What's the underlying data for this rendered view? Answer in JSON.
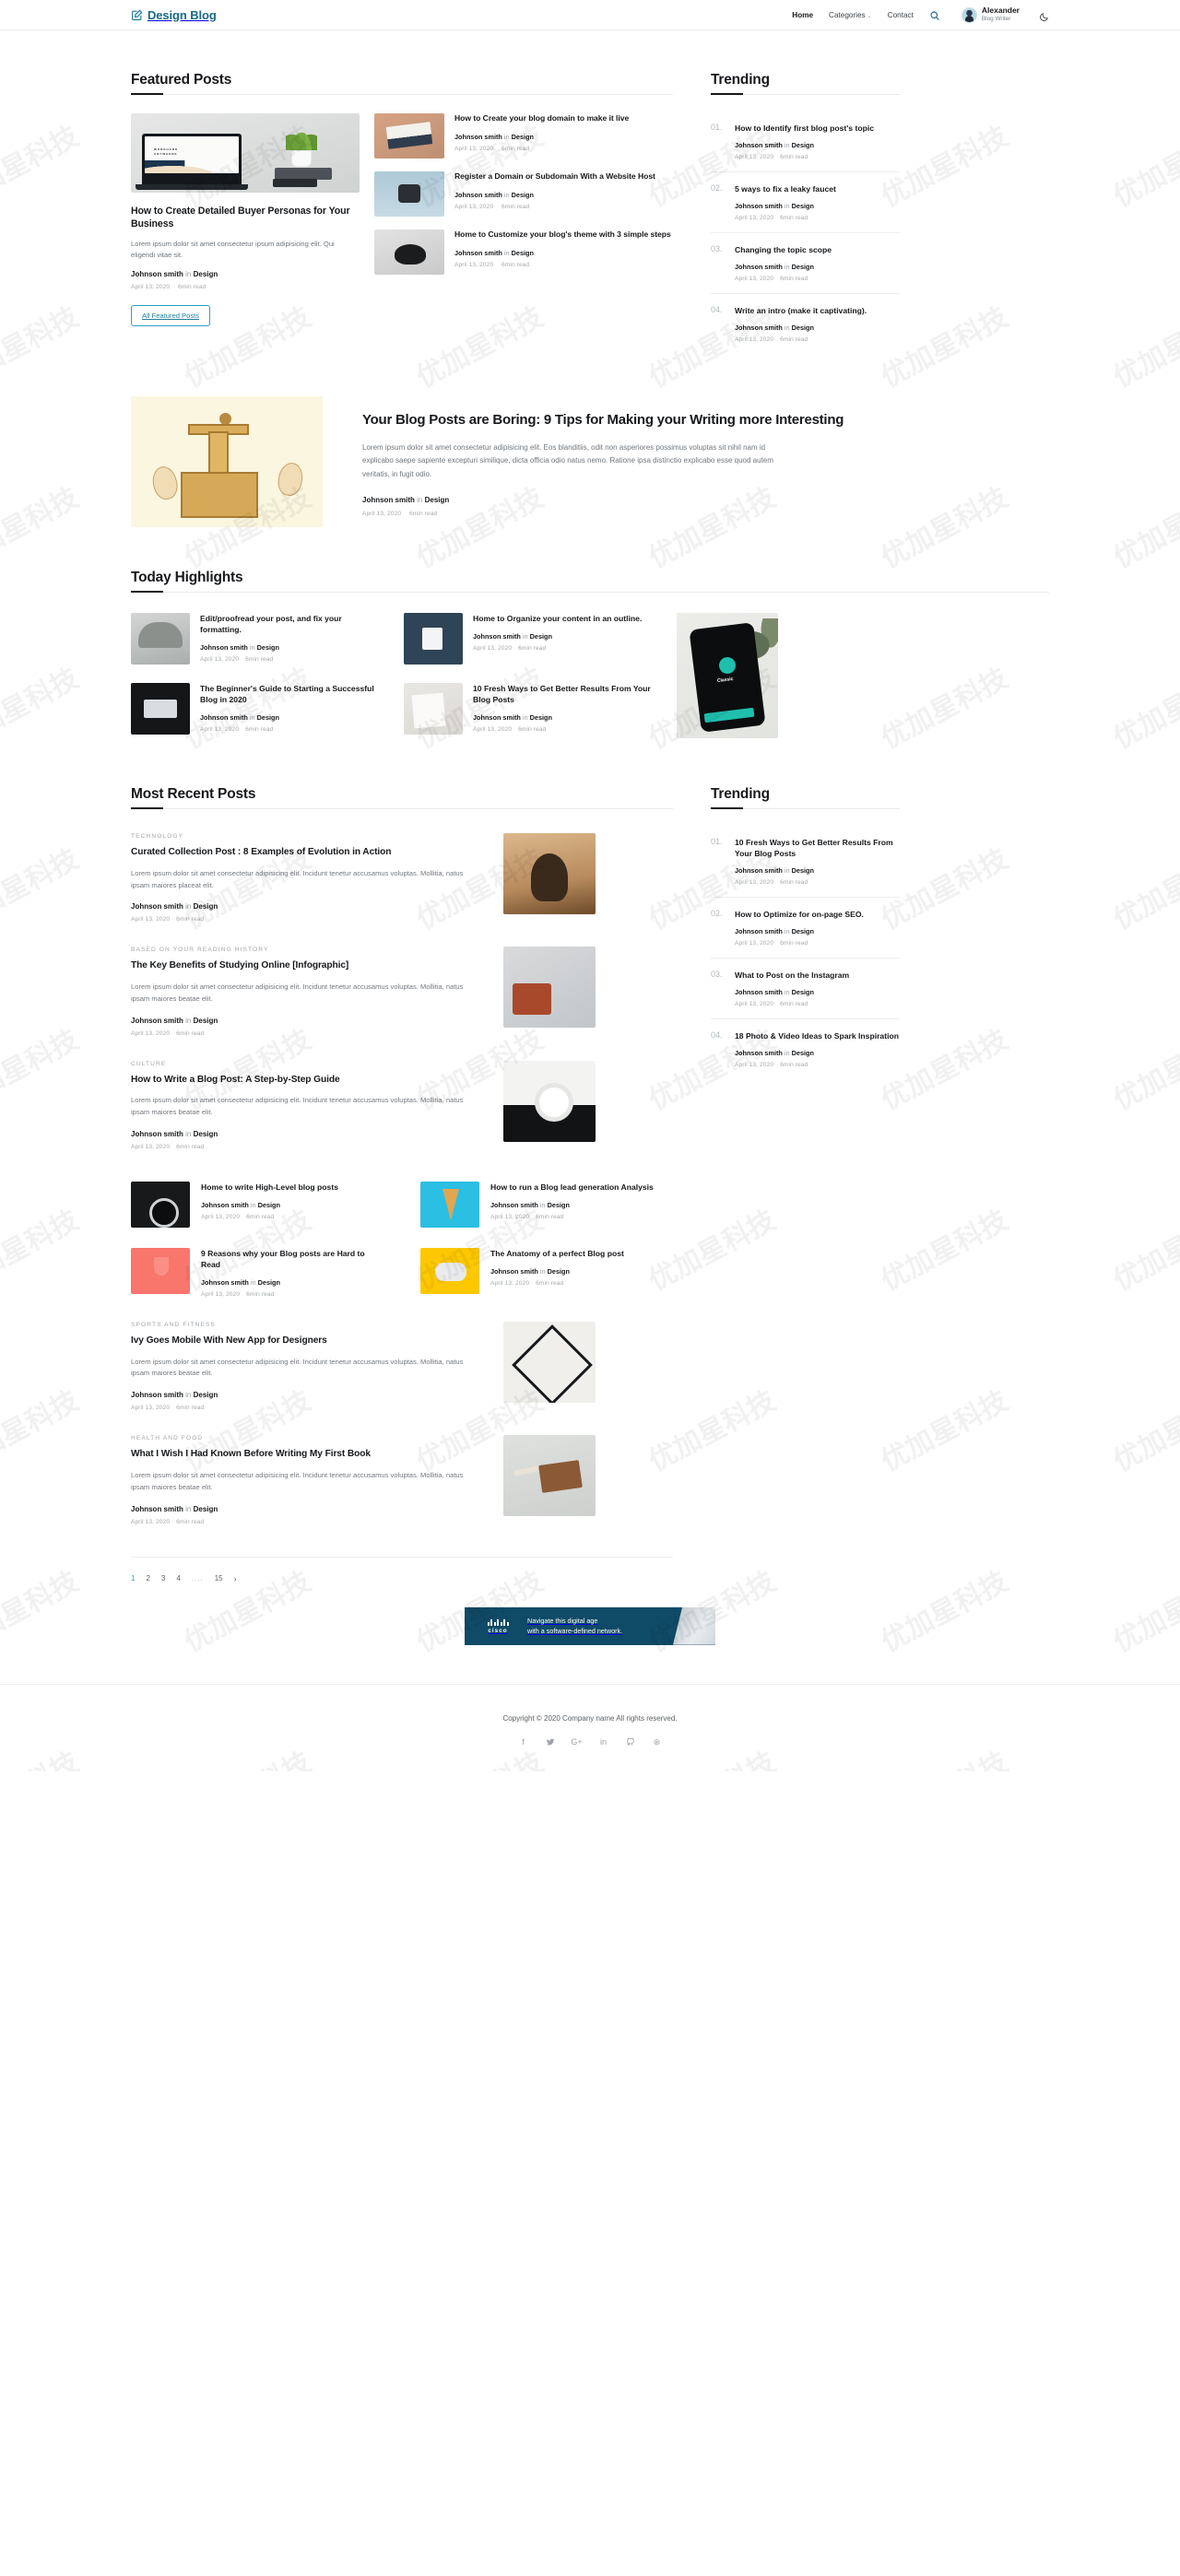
{
  "header": {
    "brand": "Design Blog",
    "brand_icon": "pencil-square-icon",
    "nav": [
      {
        "label": "Home",
        "active": true
      },
      {
        "label": "Categories",
        "caret": "⌄",
        "active": false
      },
      {
        "label": "Contact",
        "active": false
      }
    ],
    "search_icon": "search-icon",
    "user": {
      "name": "Alexander",
      "role": "Blog Writer",
      "avatar": "user-avatar"
    },
    "theme_toggle_icon": "moon-icon"
  },
  "featured": {
    "title": "Featured Posts",
    "main": {
      "title": "How to Create Detailed Buyer Personas for Your Business",
      "excerpt": "Lorem ipsum dolor sit amet consectetur ipsum adipisicing elit. Qui eligendi vitae sit.",
      "author": "Johnson smith",
      "in": "in",
      "category": "Design",
      "date": "April 13, 2020",
      "read": "6min read",
      "button": "All Featured Posts"
    },
    "items": [
      {
        "title": "How to Create your blog domain to make it live",
        "author": "Johnson smith",
        "in": "in",
        "category": "Design",
        "date": "April 13, 2020",
        "read": "6min read",
        "thumb": "books-thumb"
      },
      {
        "title": "Register a Domain or Subdomain With a Website Host",
        "author": "Johnson smith",
        "in": "in",
        "category": "Design",
        "date": "April 13, 2020",
        "read": "6min read",
        "thumb": "watch-thumb"
      },
      {
        "title": "Home to Customize your blog's theme with 3 simple steps",
        "author": "Johnson smith",
        "in": "in",
        "category": "Design",
        "date": "April 13, 2020",
        "read": "6min read",
        "thumb": "mouse-thumb"
      }
    ]
  },
  "trending_top": {
    "title": "Trending",
    "items": [
      {
        "num": "01.",
        "title": "How to Identify first blog post's topic",
        "author": "Johnson smith",
        "in": "in",
        "category": "Design",
        "date": "April 13, 2020",
        "read": "6min read"
      },
      {
        "num": "02.",
        "title": "5 ways to fix a leaky faucet",
        "author": "Johnson smith",
        "in": "in",
        "category": "Design",
        "date": "April 13, 2020",
        "read": "6min read"
      },
      {
        "num": "03.",
        "title": "Changing the topic scope",
        "author": "Johnson smith",
        "in": "in",
        "category": "Design",
        "date": "April 13, 2020",
        "read": "6min read"
      },
      {
        "num": "04.",
        "title": "Write an intro (make it captivating).",
        "author": "Johnson smith",
        "in": "in",
        "category": "Design",
        "date": "April 13, 2020",
        "read": "6min read"
      }
    ]
  },
  "hero": {
    "image": "printing-press-illustration",
    "title": "Your Blog Posts are Boring: 9 Tips for Making your Writing more Interesting",
    "excerpt": "Lorem ipsum dolor sit amet consectetur adipisicing elit. Eos blanditiis, odit non asperiores possimus voluptas sit nihil nam id explicabo saepe sapiente excepturi similique, dicta officia odio natus nemo. Ratione ipsa distinctio explicabo esse quod autem veritatis, in fugit odio.",
    "author": "Johnson smith",
    "in": "in",
    "category": "Design",
    "date": "April 13, 2020",
    "read": "6min read"
  },
  "highlights": {
    "title": "Today Highlights",
    "col1": [
      {
        "title": "Edit/proofread your post, and fix your formatting.",
        "author": "Johnson smith",
        "in": "in",
        "category": "Design",
        "date": "April 13, 2020",
        "read": "6min read",
        "thumb": "cap-thumb"
      },
      {
        "title": "The Beginner's Guide to Starting a Successful Blog in 2020",
        "author": "Johnson smith",
        "in": "in",
        "category": "Design",
        "date": "April 13, 2020",
        "read": "6min read",
        "thumb": "black-thumb"
      }
    ],
    "col2": [
      {
        "title": "Home to Organize your content in an outline.",
        "author": "Johnson smith",
        "in": "in",
        "category": "Design",
        "date": "April 13, 2020",
        "read": "6min read",
        "thumb": "mug-thumb"
      },
      {
        "title": "10 Fresh Ways to Get Better Results From Your Blog Posts",
        "author": "Johnson smith",
        "in": "in",
        "category": "Design",
        "date": "April 13, 2020",
        "read": "6min read",
        "thumb": "note-thumb"
      }
    ],
    "side_image": "phone-classic-app"
  },
  "recent": {
    "title": "Most Recent Posts",
    "posts": [
      {
        "kicker": "TECHNOLOGY",
        "title": "Curated Collection Post : 8 Examples of Evolution in Action",
        "excerpt": "Lorem ipsum dolor sit amet consectetur adipisicing elit. Incidunt tenetur accusamus voluptas. Mollitia, natus ipsam maiores placeat elit.",
        "author": "Johnson smith",
        "in": "in",
        "category": "Design",
        "date": "April 13, 2020",
        "read": "6min read",
        "image": "portrait-image"
      },
      {
        "kicker": "BASED ON YOUR READING HISTORY",
        "title": "The Key Benefits of Studying Online [Infographic]",
        "excerpt": "Lorem ipsum dolor sit amet consectetur adipisicing elit. Incidunt tenetur accusamus voluptas. Mollitia, natus ipsam maiores beatae elit.",
        "author": "Johnson smith",
        "in": "in",
        "category": "Design",
        "date": "April 13, 2020",
        "read": "6min read",
        "image": "flatlay-image"
      },
      {
        "kicker": "CULTURE",
        "title": "How to Write a Blog Post: A Step-by-Step Guide",
        "excerpt": "Lorem ipsum dolor sit amet consectetur adipisicing elit. Incidunt tenetur accusamus voluptas. Mollitia, natus ipsam maiores beatae elit.",
        "author": "Johnson smith",
        "in": "in",
        "category": "Design",
        "date": "April 13, 2020",
        "read": "6min read",
        "image": "coffee-image"
      }
    ],
    "cards": [
      {
        "title": "Home to write High-Level blog posts",
        "author": "Johnson smith",
        "in": "in",
        "category": "Design",
        "date": "April 13, 2020",
        "read": "6min read",
        "image": "coffee-card"
      },
      {
        "title": "How to run a Blog lead generation Analysis",
        "author": "Johnson smith",
        "in": "in",
        "category": "Design",
        "date": "April 13, 2020",
        "read": "6min read",
        "image": "cone-card"
      },
      {
        "title": "9 Reasons why your Blog posts are Hard to Read",
        "author": "Johnson smith",
        "in": "in",
        "category": "Design",
        "date": "April 13, 2020",
        "read": "6min read",
        "image": "glass-card"
      },
      {
        "title": "The Anatomy of a perfect Blog post",
        "author": "Johnson smith",
        "in": "in",
        "category": "Design",
        "date": "April 13, 2020",
        "read": "6min read",
        "image": "gamepad-card"
      }
    ],
    "posts_tail": [
      {
        "kicker": "SPORTS AND FITNESS",
        "title": "Ivy Goes Mobile With New App for Designers",
        "excerpt": "Lorem ipsum dolor sit amet consectetur adipisicing elit. Incidunt tenetur accusamus voluptas. Mollitia, natus ipsam maiores beatae elit.",
        "author": "Johnson smith",
        "in": "in",
        "category": "Design",
        "date": "April 13, 2020",
        "read": "6min read",
        "image": "geometric-image"
      },
      {
        "kicker": "HEALTH AND FOOD",
        "title": "What I Wish I Had Known Before Writing My First Book",
        "excerpt": "Lorem ipsum dolor sit amet consectetur adipisicing elit. Incidunt tenetur accusamus voluptas. Mollitia, natus ipsam maiores beatae elit.",
        "author": "Johnson smith",
        "in": "in",
        "category": "Design",
        "date": "April 13, 2020",
        "read": "6min read",
        "image": "book-image"
      }
    ]
  },
  "trending_bottom": {
    "title": "Trending",
    "items": [
      {
        "num": "01.",
        "title": "10 Fresh Ways to Get Better Results From Your Blog Posts",
        "author": "Johnson smith",
        "in": "in",
        "category": "Design",
        "date": "April 13, 2020",
        "read": "6min read"
      },
      {
        "num": "02.",
        "title": "How to Optimize for on-page SEO.",
        "author": "Johnson smith",
        "in": "in",
        "category": "Design",
        "date": "April 13, 2020",
        "read": "6min read"
      },
      {
        "num": "03.",
        "title": "What to Post on the Instagram",
        "author": "Johnson smith",
        "in": "in",
        "category": "Design",
        "date": "April 13, 2020",
        "read": "6min read"
      },
      {
        "num": "04.",
        "title": "18 Photo & Video Ideas to Spark Inspiration",
        "author": "Johnson smith",
        "in": "in",
        "category": "Design",
        "date": "April 13, 2020",
        "read": "6min read"
      }
    ]
  },
  "pagination": {
    "pages": [
      "1",
      "2",
      "3",
      "4"
    ],
    "dots": "....",
    "last": "15",
    "next_icon": "›",
    "current": "1"
  },
  "ad": {
    "brand": "cisco",
    "line1": "Navigate this digital age",
    "line2": "with a software-defined network.",
    "bg_color": "#0f4a66"
  },
  "footer": {
    "copyright": "Copyright © 2020 Company name All rights reserved.",
    "social": [
      {
        "name": "facebook-icon",
        "glyph": "f"
      },
      {
        "name": "twitter-icon",
        "glyph": "ᵛ"
      },
      {
        "name": "google-plus-icon",
        "glyph": "G+"
      },
      {
        "name": "linkedin-icon",
        "glyph": "in"
      },
      {
        "name": "github-icon",
        "glyph": "○"
      },
      {
        "name": "dribbble-icon",
        "glyph": "⊛"
      }
    ]
  },
  "watermark": {
    "text": "优加星科技"
  }
}
